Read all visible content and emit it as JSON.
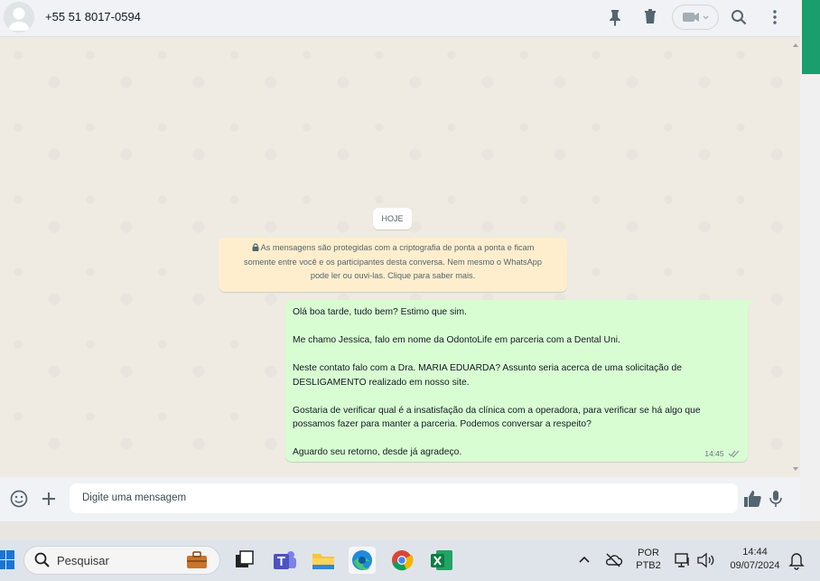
{
  "header": {
    "contact": "+55 51 8017-0594",
    "icons": [
      "pin-icon",
      "trash-icon",
      "video-call-icon",
      "search-icon",
      "more-icon"
    ]
  },
  "chat": {
    "date_label": "HOJE",
    "encryption_notice": [
      "As mensagens são protegidas com a criptografia de ponta a ponta e ficam",
      "somente entre você e os participantes desta conversa. Nem mesmo o WhatsApp",
      "pode ler ou ouvi-las. Clique para saber mais."
    ],
    "message": {
      "paragraphs": [
        "Olá boa tarde, tudo bem? Estimo que sim.",
        "Me chamo Jessica, falo em nome da OdontoLife em parceria com a Dental Uni.",
        "Neste contato falo com a Dra. MARIA EDUARDA? Assunto seria acerca de uma solicitação de DESLIGAMENTO realizado em nosso site.",
        "Gostaria de verificar qual é a insatisfação da clínica com a operadora, para verificar se há algo que possamos fazer para manter a parceria. Podemos conversar a respeito?",
        "Aguardo seu retorno, desde já agradeço."
      ],
      "time": "14:45",
      "status": "delivered"
    }
  },
  "composer": {
    "placeholder": "Digite uma mensagem"
  },
  "taskbar": {
    "search_label": "Pesquisar",
    "lang_top": "POR",
    "lang_bottom": "PTB2",
    "time": "14:44",
    "date": "09/07/2024"
  },
  "colors": {
    "bubble": "#d9fdd3",
    "notice": "#ffeecd",
    "accent": "#1a9e6e"
  }
}
